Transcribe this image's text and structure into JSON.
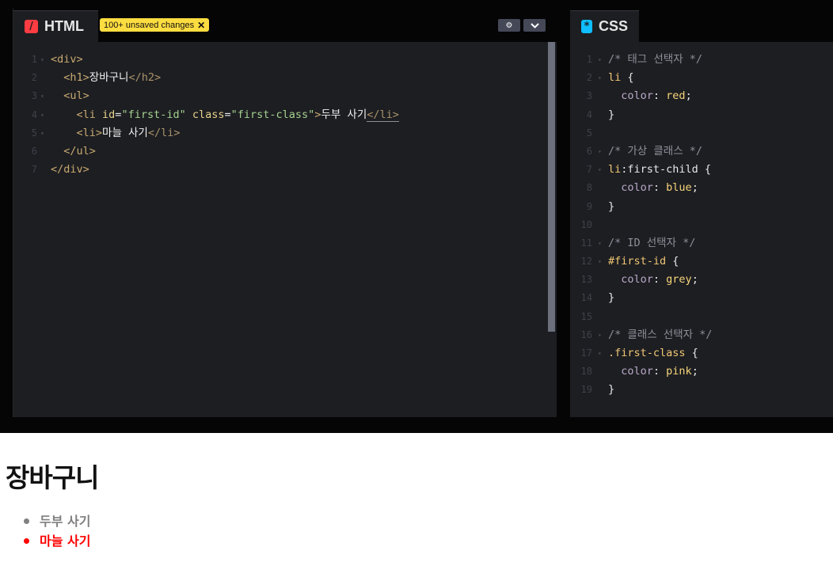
{
  "html_panel": {
    "tab_label": "HTML",
    "logo_glyph": "/",
    "logo_color": "#ff3c41",
    "unsaved_badge": "100+ unsaved changes",
    "badge_close": "✕",
    "settings_icon": "⚙",
    "collapse_icon": "⌄",
    "lines": [
      {
        "n": "1",
        "fold": "▾",
        "parts": [
          [
            "tag",
            "<div>"
          ]
        ]
      },
      {
        "n": "2",
        "fold": "",
        "parts": [
          [
            "txt",
            "  "
          ],
          [
            "tag",
            "<h1>"
          ],
          [
            "txt",
            "장바구니"
          ],
          [
            "tag2",
            "</h2>"
          ]
        ]
      },
      {
        "n": "3",
        "fold": "▾",
        "parts": [
          [
            "txt",
            "  "
          ],
          [
            "tag",
            "<ul>"
          ]
        ]
      },
      {
        "n": "4",
        "fold": "▾",
        "parts": [
          [
            "txt",
            "    "
          ],
          [
            "tag",
            "<li "
          ],
          [
            "attr",
            "id"
          ],
          [
            "pun",
            "="
          ],
          [
            "str",
            "\"first-id\""
          ],
          [
            "attr",
            " class"
          ],
          [
            "pun",
            "="
          ],
          [
            "str",
            "\"first-class\""
          ],
          [
            "tag",
            ">"
          ],
          [
            "txt",
            "두부 사기"
          ],
          [
            "tagu",
            "</li>"
          ]
        ]
      },
      {
        "n": "5",
        "fold": "▾",
        "parts": [
          [
            "txt",
            "    "
          ],
          [
            "tag",
            "<li>"
          ],
          [
            "txt",
            "마늘 사기"
          ],
          [
            "tag2",
            "</li>"
          ]
        ]
      },
      {
        "n": "6",
        "fold": "",
        "parts": [
          [
            "txt",
            "  "
          ],
          [
            "tag",
            "</ul>"
          ]
        ]
      },
      {
        "n": "7",
        "fold": "",
        "parts": [
          [
            "tag",
            "</div>"
          ]
        ]
      }
    ]
  },
  "css_panel": {
    "tab_label": "CSS",
    "logo_glyph": "*",
    "logo_color": "#0ebeff",
    "lines": [
      {
        "n": "1",
        "fold": "▾",
        "parts": [
          [
            "com",
            "/* 태그 선택자 */"
          ]
        ]
      },
      {
        "n": "2",
        "fold": "▾",
        "parts": [
          [
            "sel",
            "li"
          ],
          [
            "pun",
            " {"
          ]
        ]
      },
      {
        "n": "3",
        "fold": "",
        "parts": [
          [
            "txt",
            "  "
          ],
          [
            "prop",
            "color"
          ],
          [
            "pun",
            ": "
          ],
          [
            "val",
            "red"
          ],
          [
            "pun",
            ";"
          ]
        ]
      },
      {
        "n": "4",
        "fold": "",
        "parts": [
          [
            "pun",
            "}"
          ]
        ]
      },
      {
        "n": "5",
        "fold": "",
        "parts": []
      },
      {
        "n": "6",
        "fold": "▾",
        "parts": [
          [
            "com",
            "/* 가상 클래스 */"
          ]
        ]
      },
      {
        "n": "7",
        "fold": "▾",
        "parts": [
          [
            "sel",
            "li"
          ],
          [
            "pun",
            ":first-child {"
          ]
        ]
      },
      {
        "n": "8",
        "fold": "",
        "parts": [
          [
            "txt",
            "  "
          ],
          [
            "prop",
            "color"
          ],
          [
            "pun",
            ": "
          ],
          [
            "val",
            "blue"
          ],
          [
            "pun",
            ";"
          ]
        ]
      },
      {
        "n": "9",
        "fold": "",
        "parts": [
          [
            "pun",
            "}"
          ]
        ]
      },
      {
        "n": "10",
        "fold": "",
        "parts": []
      },
      {
        "n": "11",
        "fold": "▾",
        "parts": [
          [
            "com",
            "/* ID 선택자 */"
          ]
        ]
      },
      {
        "n": "12",
        "fold": "▾",
        "parts": [
          [
            "sel",
            "#first-id"
          ],
          [
            "pun",
            " {"
          ]
        ]
      },
      {
        "n": "13",
        "fold": "",
        "parts": [
          [
            "txt",
            "  "
          ],
          [
            "prop",
            "color"
          ],
          [
            "pun",
            ": "
          ],
          [
            "val",
            "grey"
          ],
          [
            "pun",
            ";"
          ]
        ]
      },
      {
        "n": "14",
        "fold": "",
        "parts": [
          [
            "pun",
            "}"
          ]
        ]
      },
      {
        "n": "15",
        "fold": "",
        "parts": []
      },
      {
        "n": "16",
        "fold": "▾",
        "parts": [
          [
            "com",
            "/* 클래스 선택자 */"
          ]
        ]
      },
      {
        "n": "17",
        "fold": "▾",
        "parts": [
          [
            "sel",
            ".first-class"
          ],
          [
            "pun",
            " {"
          ]
        ]
      },
      {
        "n": "18",
        "fold": "",
        "parts": [
          [
            "txt",
            "  "
          ],
          [
            "prop",
            "color"
          ],
          [
            "pun",
            ": "
          ],
          [
            "val",
            "pink"
          ],
          [
            "pun",
            ";"
          ]
        ]
      },
      {
        "n": "19",
        "fold": "",
        "parts": [
          [
            "pun",
            "}"
          ]
        ]
      }
    ]
  },
  "preview": {
    "heading": "장바구니",
    "items": [
      {
        "text": "두부 사기",
        "color": "#808080"
      },
      {
        "text": "마늘 사기",
        "color": "#ff0000"
      }
    ]
  }
}
